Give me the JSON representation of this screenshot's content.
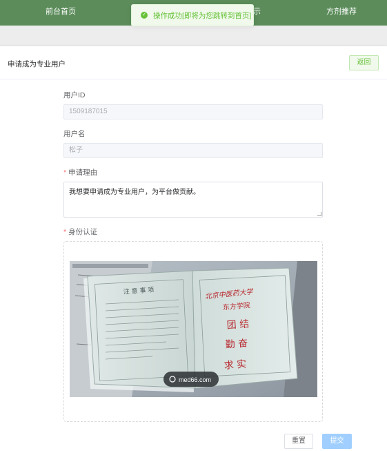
{
  "nav": {
    "items": [
      {
        "label": "前台首页"
      },
      {
        "label": "示"
      },
      {
        "label": "方剂推荐"
      }
    ]
  },
  "toast": {
    "message": "操作成功[即将为您跳转到首页]",
    "icon": "check-circle-icon",
    "color": "#67c23a"
  },
  "card": {
    "title": "申请成为专业用户",
    "back_label": "返回"
  },
  "form": {
    "user_id": {
      "label": "用户ID",
      "value": "1509187015"
    },
    "username": {
      "label": "用户名",
      "value": "松子"
    },
    "reason": {
      "label": "申请理由",
      "required_mark": "*",
      "value": "我想要申请成为专业用户，为平台做贡献。"
    },
    "identity": {
      "label": "身份认证",
      "required_mark": "*",
      "photo": {
        "left_page_heading": "注 意 事 项",
        "right_page_school": "北京中医药大学",
        "right_page_college": "东方学院",
        "right_page_motto_1": "团 结",
        "right_page_motto_2": "勤 奋",
        "right_page_motto_3": "求 实",
        "watermark": "med66.com"
      }
    },
    "reset_label": "重置",
    "submit_label": "提交"
  },
  "colors": {
    "nav_bg": "#5b8c5a",
    "success": "#67c23a",
    "primary_disabled": "#a0cfff",
    "required": "#f56c6c"
  }
}
